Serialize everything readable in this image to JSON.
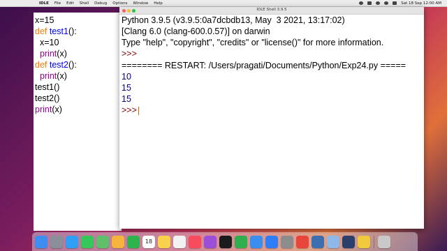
{
  "menubar": {
    "app": "IDLE",
    "items": [
      "File",
      "Edit",
      "Shell",
      "Debug",
      "Options",
      "Window",
      "Help"
    ],
    "clock": "Sat 18 Sep  12:00 AM"
  },
  "editor": {
    "lines": [
      {
        "parts": [
          {
            "t": "x=15",
            "c": "plain"
          }
        ]
      },
      {
        "parts": [
          {
            "t": "def ",
            "c": "kw"
          },
          {
            "t": "test1",
            "c": "fn"
          },
          {
            "t": "():",
            "c": "plain"
          }
        ]
      },
      {
        "parts": [
          {
            "t": "  x=10",
            "c": "plain"
          }
        ]
      },
      {
        "parts": [
          {
            "t": "  ",
            "c": "plain"
          },
          {
            "t": "print",
            "c": "bi"
          },
          {
            "t": "(x)",
            "c": "plain"
          }
        ]
      },
      {
        "parts": [
          {
            "t": "def ",
            "c": "kw"
          },
          {
            "t": "test2",
            "c": "fn"
          },
          {
            "t": "():",
            "c": "plain"
          }
        ]
      },
      {
        "parts": [
          {
            "t": "  ",
            "c": "plain"
          },
          {
            "t": "print",
            "c": "bi"
          },
          {
            "t": "(x)",
            "c": "plain"
          }
        ]
      },
      {
        "parts": [
          {
            "t": "test1()",
            "c": "plain"
          }
        ]
      },
      {
        "parts": [
          {
            "t": "test2()",
            "c": "plain"
          }
        ]
      },
      {
        "parts": [
          {
            "t": "print",
            "c": "bi"
          },
          {
            "t": "(x)",
            "c": "plain"
          }
        ]
      }
    ]
  },
  "shell": {
    "title": "IDLE Shell 3.9.5",
    "banner1": "Python 3.9.5 (v3.9.5:0a7dcbdb13, May  3 2021, 13:17:02)",
    "banner2": "[Clang 6.0 (clang-600.0.57)] on darwin",
    "banner3": "Type \"help\", \"copyright\", \"credits\" or \"license()\" for more information.",
    "prompt": ">>>",
    "restart": "======== RESTART: /Users/pragati/Documents/Python/Exp24.py =====",
    "outputs": [
      "10",
      "15",
      "15"
    ]
  },
  "dock": {
    "icons": [
      "finder-icon",
      "launchpad-icon",
      "safari-icon",
      "messages-icon",
      "maps-icon",
      "photos-icon",
      "facetime-icon",
      "calendar-icon",
      "notes-icon",
      "reminders-icon",
      "music-icon",
      "podcasts-icon",
      "tv-icon",
      "numbers-icon",
      "keynote-icon",
      "appstore-icon",
      "settings-icon",
      "chrome-icon",
      "python-icon",
      "preview-icon",
      "quicktime-icon",
      "idle-icon",
      "trash-icon"
    ],
    "calendar_day": "18"
  }
}
